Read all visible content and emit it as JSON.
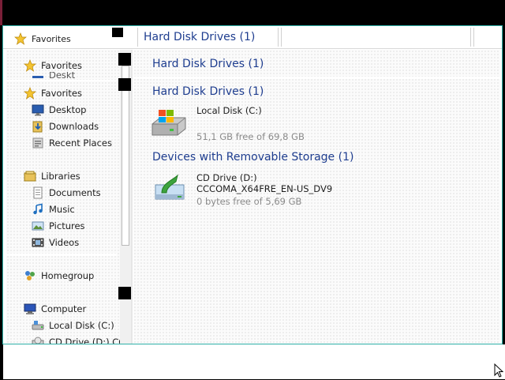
{
  "header": {
    "favorites_label": "Favorites",
    "title": "Hard Disk Drives (1)"
  },
  "sidebar": {
    "favorites_header": "Favorites",
    "ghost_favorites": "Favorites",
    "ghost_desktop": "Deskt",
    "favorites": [
      {
        "label": "Desktop",
        "icon": "desktop-icon"
      },
      {
        "label": "Downloads",
        "icon": "downloads-icon"
      },
      {
        "label": "Recent Places",
        "icon": "recent-places-icon"
      }
    ],
    "libraries_header": "Libraries",
    "libraries": [
      {
        "label": "Documents",
        "icon": "documents-icon"
      },
      {
        "label": "Music",
        "icon": "music-icon"
      },
      {
        "label": "Pictures",
        "icon": "pictures-icon"
      },
      {
        "label": "Videos",
        "icon": "videos-icon"
      }
    ],
    "homegroup": "Homegroup",
    "computer_header": "Computer",
    "computer": [
      {
        "label": "Local Disk (C:)",
        "icon": "local-disk-icon"
      },
      {
        "label": "CD Drive (D:) CC",
        "icon": "cd-drive-icon"
      }
    ]
  },
  "main": {
    "ghost_group": "Hard Disk Drives (1)",
    "hdd_group": "Hard Disk Drives (1)",
    "local_disk": {
      "name": "Local Disk (C:)",
      "free": "51,1 GB free of 69,8 GB"
    },
    "removable_group": "Devices with Removable Storage (1)",
    "cd_drive": {
      "name": "CD Drive (D:)",
      "label": "CCCOMA_X64FRE_EN-US_DV9",
      "free": "0 bytes free of 5,69 GB"
    }
  },
  "colors": {
    "group_title": "#1e3d8f",
    "window_border": "#2fb0a8"
  }
}
